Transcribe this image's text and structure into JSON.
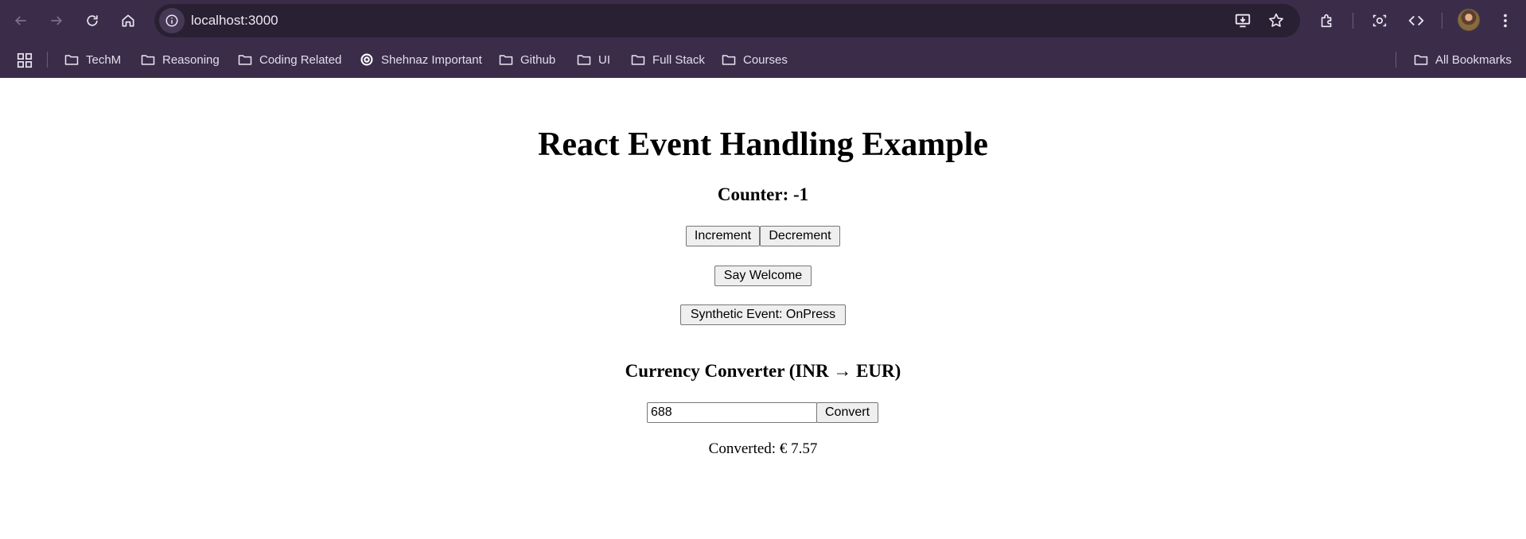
{
  "browser": {
    "url": "localhost:3000",
    "accent": "#3b2d4a",
    "bookmarks": [
      {
        "label": "TechM",
        "icon": "folder-icon"
      },
      {
        "label": "Reasoning",
        "icon": "folder-icon"
      },
      {
        "label": "Coding Related",
        "icon": "folder-icon"
      },
      {
        "label": "Shehnaz Important",
        "icon": "openai-icon"
      },
      {
        "label": "Github",
        "icon": "folder-icon"
      },
      {
        "label": "UI",
        "icon": "folder-icon"
      },
      {
        "label": "Full Stack",
        "icon": "folder-icon"
      },
      {
        "label": "Courses",
        "icon": "folder-icon"
      }
    ],
    "all_bookmarks_label": "All Bookmarks"
  },
  "page": {
    "title": "React Event Handling Example",
    "counter_label": "Counter: -1",
    "increment_label": "Increment",
    "decrement_label": "Decrement",
    "welcome_label": "Say Welcome",
    "synthetic_label": "Synthetic Event: OnPress",
    "converter_title": "Currency Converter (INR → EUR)",
    "amount_value": "688",
    "convert_label": "Convert",
    "result_text": "Converted: € 7.57"
  }
}
